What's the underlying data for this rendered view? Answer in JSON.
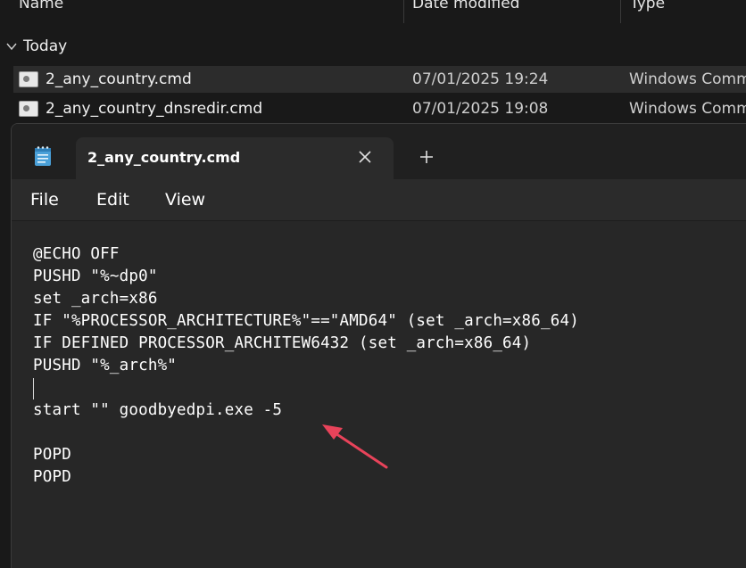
{
  "explorer": {
    "columns": {
      "name": "Name",
      "date_modified": "Date modified",
      "type": "Type"
    },
    "group_label": "Today",
    "files": [
      {
        "name": "2_any_country.cmd",
        "date": "07/01/2025 19:24",
        "type": "Windows Comm"
      },
      {
        "name": "2_any_country_dnsredir.cmd",
        "date": "07/01/2025 19:08",
        "type": "Windows Comm"
      }
    ]
  },
  "notepad": {
    "tab_title": "2_any_country.cmd",
    "menu": {
      "file": "File",
      "edit": "Edit",
      "view": "View"
    },
    "lines": [
      "@ECHO OFF",
      "PUSHD \"%~dp0\"",
      "set _arch=x86",
      "IF \"%PROCESSOR_ARCHITECTURE%\"==\"AMD64\" (set _arch=x86_64)",
      "IF DEFINED PROCESSOR_ARCHITEW6432 (set _arch=x86_64)",
      "PUSHD \"%_arch%\"",
      "",
      "start \"\" goodbyedpi.exe -5",
      "",
      "POPD",
      "POPD"
    ]
  },
  "colors": {
    "accent_arrow": "#e8435a",
    "background": "#191919",
    "editor_bg": "#272727"
  }
}
